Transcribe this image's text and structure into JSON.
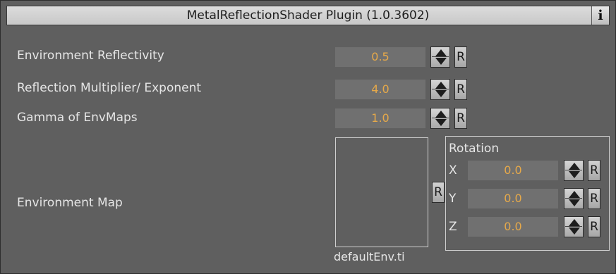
{
  "panel": {
    "title": "MetalReflectionShader Plugin (1.0.3602)",
    "info_label": "i"
  },
  "params": [
    {
      "label": "Environment Reflectivity",
      "value": "0.5",
      "reset": "R"
    },
    {
      "label": "Reflection Multiplier/ Exponent",
      "value": "4.0",
      "reset": "R"
    },
    {
      "label": "Gamma of EnvMaps",
      "value": "1.0",
      "reset": "R"
    }
  ],
  "env_map": {
    "label": "Environment Map",
    "filename": "defaultEnv.ti",
    "reset": "R"
  },
  "rotation": {
    "title": "Rotation",
    "axes": [
      {
        "axis": "X",
        "value": "0.0",
        "reset": "R"
      },
      {
        "axis": "Y",
        "value": "0.0",
        "reset": "R"
      },
      {
        "axis": "Z",
        "value": "0.0",
        "reset": "R"
      }
    ]
  },
  "colors": {
    "background": "#5f5f5f",
    "value_text": "#e6a94a",
    "field": "#707070",
    "title_bar": "#d2d2d2"
  }
}
